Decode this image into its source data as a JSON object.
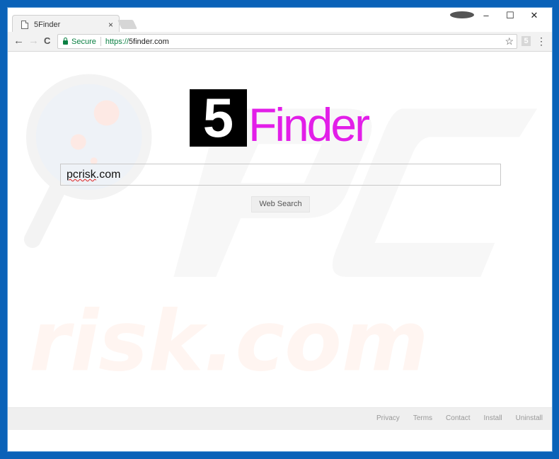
{
  "browser": {
    "tab": {
      "title": "5Finder",
      "close_glyph": "×",
      "icon": "page-icon"
    },
    "window_controls": {
      "minimize": "–",
      "maximize": "☐",
      "close": "✕"
    },
    "nav": {
      "back": "←",
      "forward": "→",
      "reload": "C"
    },
    "omnibox": {
      "security_label": "Secure",
      "url_scheme": "https://",
      "url_host": "5finder.com",
      "bookmark_glyph": "☆"
    },
    "extension_label": "5",
    "menu_glyph": "⋮"
  },
  "page": {
    "logo": {
      "box_text": "5",
      "word": "Finder",
      "accent": "#e21ee8"
    },
    "search": {
      "value_spell": "pcrisk",
      "value_rest": ".com",
      "button_label": "Web Search"
    },
    "footer_links": [
      "Privacy",
      "Terms",
      "Contact",
      "Install",
      "Uninstall"
    ],
    "watermark": {
      "top": "PC",
      "bottom": "risk.com"
    }
  },
  "colors": {
    "frame": "#0a62b8",
    "secure_green": "#0b8043"
  }
}
